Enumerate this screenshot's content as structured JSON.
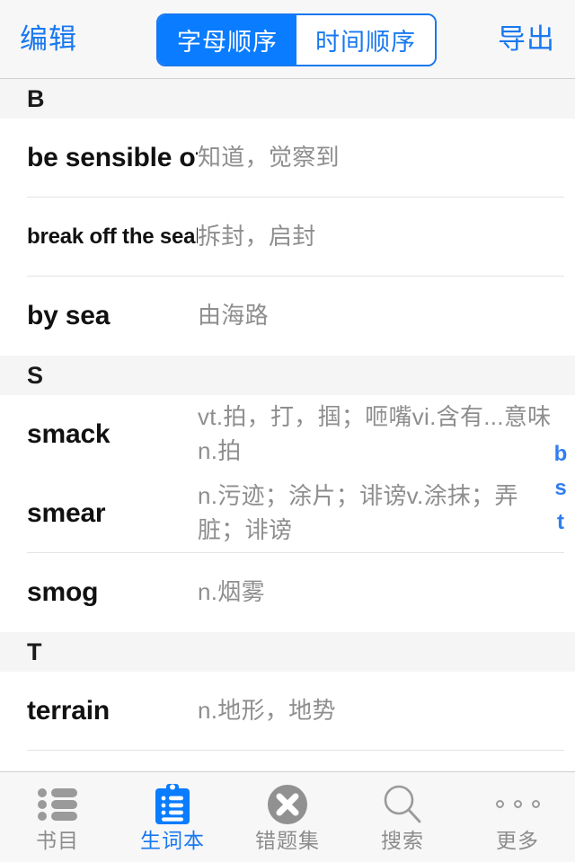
{
  "topbar": {
    "edit_label": "编辑",
    "export_label": "导出",
    "segments": [
      {
        "label": "字母顺序",
        "active": true
      },
      {
        "label": "时间顺序",
        "active": false
      }
    ],
    "accent_color": "#007AFF"
  },
  "list": {
    "sections": [
      {
        "header": "B",
        "rows": [
          {
            "word": "be sensible of",
            "definition": "知道，觉察到",
            "shrink": false
          },
          {
            "word": "break off the seal",
            "definition": "拆封，启封",
            "shrink": true
          },
          {
            "word": "by sea",
            "definition": "由海路",
            "shrink": false
          }
        ]
      },
      {
        "header": "S",
        "rows": [
          {
            "word": "smack",
            "definition": "vt.拍，打，掴；咂嘴vi.含有...意味\nn.拍",
            "shrink": false
          },
          {
            "word": "smear",
            "definition": "n.污迹；涂片；诽谤v.涂抹；弄\n脏；诽谤",
            "shrink": false
          },
          {
            "word": "smog",
            "definition": "n.烟雾",
            "shrink": false
          }
        ]
      },
      {
        "header": "T",
        "rows": [
          {
            "word": "terrain",
            "definition": "n.地形，地势",
            "shrink": false
          }
        ]
      }
    ],
    "index_letters": [
      "b",
      "s",
      "t"
    ],
    "index_color": "#2F7EF0"
  },
  "tabbar": {
    "tabs": [
      {
        "label": "书目",
        "icon": "list-icon",
        "active": false
      },
      {
        "label": "生词本",
        "icon": "clipboard-icon",
        "active": true
      },
      {
        "label": "错题集",
        "icon": "x-circle-icon",
        "active": false
      },
      {
        "label": "搜索",
        "icon": "search-icon",
        "active": false
      },
      {
        "label": "更多",
        "icon": "ellipsis-icon",
        "active": false
      }
    ],
    "active_color": "#1878F0",
    "inactive_color": "#8C8C8C"
  }
}
